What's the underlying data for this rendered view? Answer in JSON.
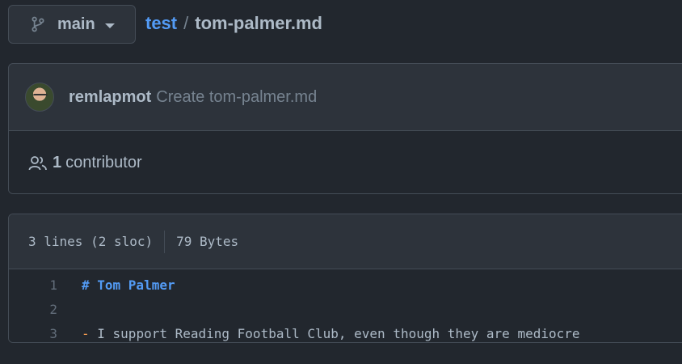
{
  "branch": {
    "icon": "git-branch-icon",
    "name": "main"
  },
  "breadcrumb": {
    "repo": "test",
    "separator": "/",
    "file": "tom-palmer.md"
  },
  "commit": {
    "author": "remlapmot",
    "message": "Create tom-palmer.md"
  },
  "contributors": {
    "icon": "people-icon",
    "count": "1",
    "label": "contributor"
  },
  "file_info": {
    "lines": "3 lines (2 sloc)",
    "size": "79 Bytes"
  },
  "code_lines": [
    {
      "num": "1",
      "prefix": "# Tom Palmer",
      "text": ""
    },
    {
      "num": "2",
      "prefix": "",
      "text": ""
    },
    {
      "num": "3",
      "prefix": "-",
      "text": " I support Reading Football Club, even though they are mediocre"
    }
  ],
  "colors": {
    "background": "#22272e",
    "surface": "#2d333b",
    "border": "#444c56",
    "link": "#539bf5",
    "text": "#adbac7",
    "muted": "#768390",
    "bullet": "#f69d50"
  }
}
